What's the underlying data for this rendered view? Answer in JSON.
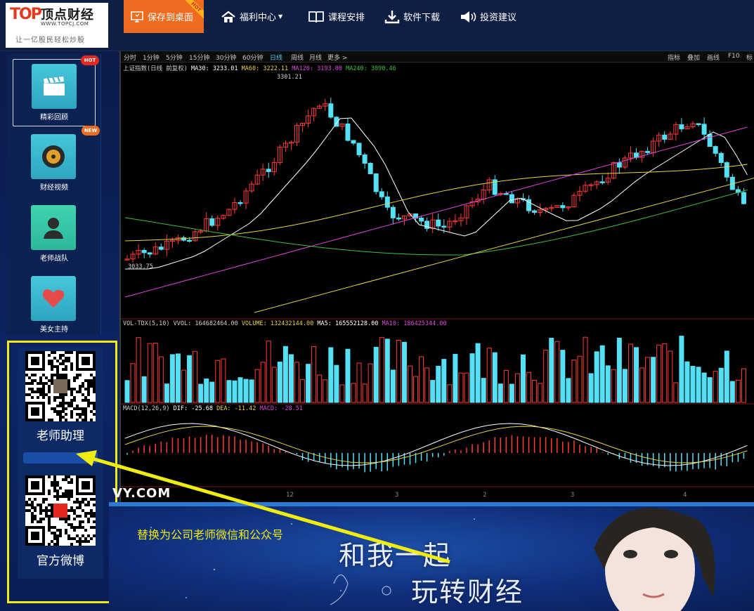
{
  "header": {
    "logo_mark": "TOP",
    "logo_name": "顶点财经",
    "logo_url": "WWW.TOPCJ.COM",
    "slogan": "让一亿股民轻松炒股",
    "save_button": "保存到桌面",
    "save_ribbon": "HOT",
    "nav": [
      {
        "label": "福利中心",
        "icon": "house-icon",
        "dropdown": true
      },
      {
        "label": "课程安排",
        "icon": "book-icon"
      },
      {
        "label": "软件下载",
        "icon": "download-icon"
      },
      {
        "label": "投资建议",
        "icon": "speaker-icon"
      }
    ]
  },
  "sidebar": {
    "items": [
      {
        "label": "精彩回顾",
        "icon": "clapperboard-icon",
        "badge": "HOT",
        "active": true
      },
      {
        "label": "财经视频",
        "icon": "disc-icon",
        "badge": "NEW"
      },
      {
        "label": "老师战队",
        "icon": "person-icon"
      },
      {
        "label": "美女主持",
        "icon": "heart-icon"
      }
    ],
    "qr_codes": [
      {
        "label": "老师助理"
      },
      {
        "label": "官方微博"
      }
    ]
  },
  "chart_toolbar": {
    "periods": [
      "分时",
      "1分钟",
      "5分钟",
      "15分钟",
      "30分钟",
      "60分钟",
      "日线",
      "周线",
      "月线",
      "更多 >"
    ],
    "selected": "日线",
    "right_tools": [
      "指标",
      "叠加",
      "画线",
      "F10",
      "标"
    ]
  },
  "legends": {
    "main_title": "上证指数(日线 前复权)",
    "ma30": "MA30: 3233.01",
    "ma60": "MA60: 3222.11",
    "ma120": "MA120: 3193.00",
    "ma240": "MA240: 3090.46",
    "high_label": "3301.21",
    "low_label": "3033.75",
    "vol_title": "VOL-TDX(5,10)",
    "vvol": "VVOL: 164682464.00",
    "volume": "VOLUME: 132432144.00",
    "vol_ma5": "MA5: 165552128.00",
    "vol_ma10": "MA10: 186425344.00",
    "macd_title": "MACD(12,26,9)",
    "dif": "DIF: -25.68",
    "dea": "DEA: -11.42",
    "macd": "MACD: -28.51",
    "indicator_bar": "VY.COM",
    "x_ticks": [
      "12",
      "3",
      "2",
      "3",
      "4"
    ]
  },
  "colors": {
    "up": "#ff3b3b",
    "down": "#54e0f5",
    "ma30": "#ffffff",
    "ma60": "#e8d24a",
    "ma120": "#e047e0",
    "ma240": "#3fbf3f",
    "highlight": "#f1ec0f",
    "accent": "#ef6b1f"
  },
  "banner": {
    "line1": "和我一起",
    "line2": "玩转财经"
  },
  "annotation": {
    "note": "替换为公司老师微信和公众号"
  },
  "chart_data": {
    "type": "candlestick",
    "title": "上证指数(日线 前复权)",
    "ylim": [
      3033.75,
      3301.21
    ],
    "high": 3301.21,
    "low": 3033.75
  }
}
